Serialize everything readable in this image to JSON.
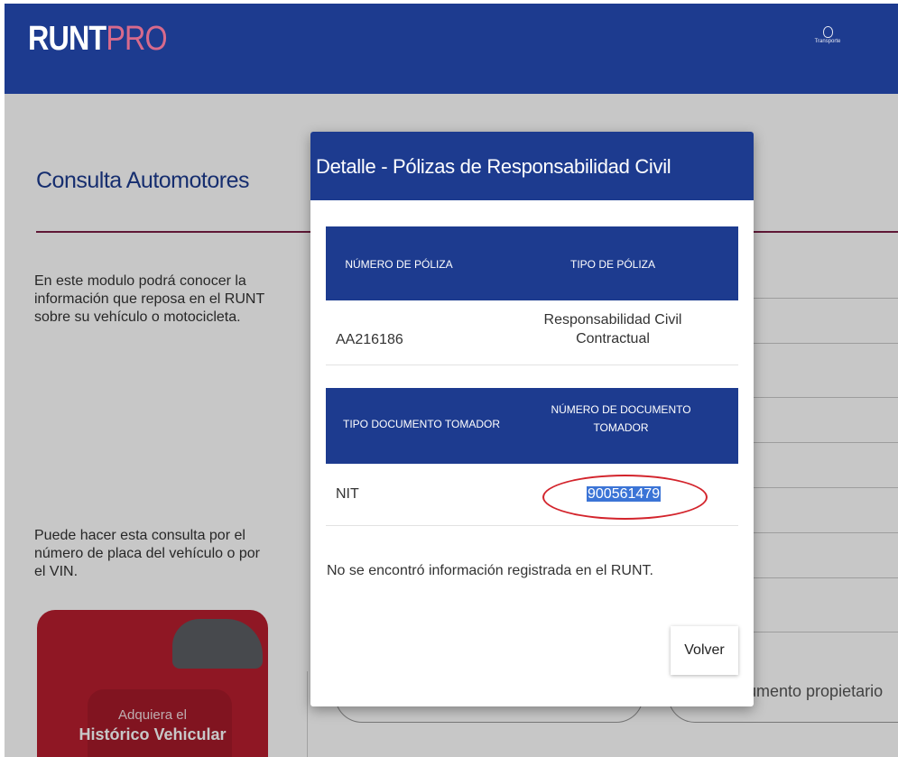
{
  "header": {
    "brand_runt": "RUNT",
    "brand_pro": "PRO",
    "logo_label": "Transporte"
  },
  "page": {
    "title": "Consulta Automotores",
    "description": "En este modulo podrá conocer la información que reposa en el RUNT sobre su vehículo o motocicleta.",
    "instructions": "Puede hacer esta consulta por el número de placa del vehículo o por el VIN.",
    "promo_line1": "Adquiera el",
    "promo_line2": "Histórico Vehicular",
    "field_placeholder": "umento propietario"
  },
  "modal": {
    "title": "Detalle - Pólizas de Responsabilidad Civil",
    "table1": {
      "headers": [
        "NÚMERO DE PÓLIZA",
        "TIPO DE PÓLIZA"
      ],
      "row": [
        "AA216186",
        "Responsabilidad Civil Contractual"
      ]
    },
    "table2": {
      "headers": [
        "TIPO DOCUMENTO TOMADOR",
        "NÚMERO DE DOCUMENTO TOMADOR"
      ],
      "row": [
        "NIT",
        "900561479"
      ]
    },
    "note": "No se encontró información registrada en el RUNT.",
    "back_button": "Volver"
  },
  "colors": {
    "primary": "#1d3b8f",
    "accent": "#d76a8c",
    "highlight": "#3b74d6",
    "annotation": "#d3242c"
  }
}
